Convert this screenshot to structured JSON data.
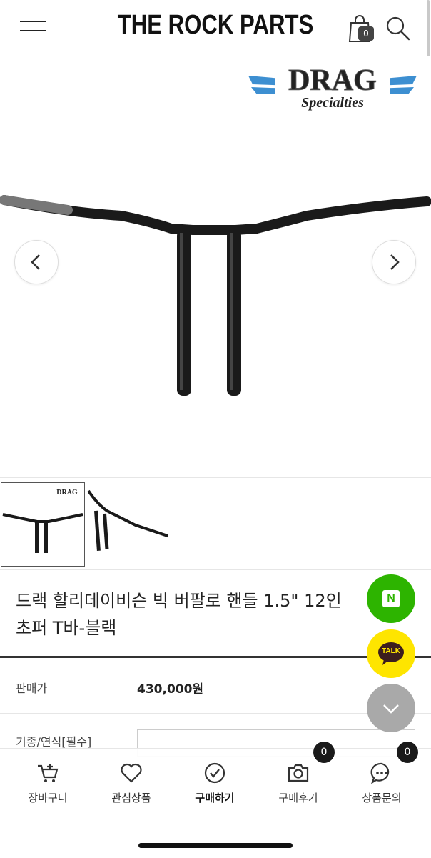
{
  "header": {
    "store_name": "THE ROCK PARTS",
    "cart_count": "0",
    "icons": {
      "menu": "hamburger-icon",
      "cart": "shopping-bag-icon",
      "search": "search-icon"
    }
  },
  "hero": {
    "brand_logo": {
      "line1": "DRAG",
      "line2": "Specialties"
    },
    "prev_icon": "chevron-left-icon",
    "next_icon": "chevron-right-icon"
  },
  "product": {
    "title_line1": "드랙 할리데이비슨 빅 버팔로 핸들 1.5\" 12인",
    "title_line2": "초퍼 T바-블랙",
    "price_label": "판매가",
    "price_value": "430,000원",
    "model_label": "기종/연식[필수]"
  },
  "floating": {
    "naver_label": "N",
    "kakao_label": "TALK",
    "scroll_icon": "chevron-down-icon"
  },
  "bottom_nav": {
    "items": [
      {
        "label": "장바구니",
        "icon": "cart-plus-icon"
      },
      {
        "label": "관심상품",
        "icon": "heart-icon"
      },
      {
        "label": "구매하기",
        "icon": "check-circle-icon"
      },
      {
        "label": "구매후기",
        "icon": "camera-icon",
        "badge": "0"
      },
      {
        "label": "상품문의",
        "icon": "chat-bubble-icon",
        "badge": "0"
      }
    ]
  },
  "colors": {
    "naver_green": "#2db400",
    "kakao_yellow": "#fee500",
    "badge_dark": "#1a1a1a"
  }
}
